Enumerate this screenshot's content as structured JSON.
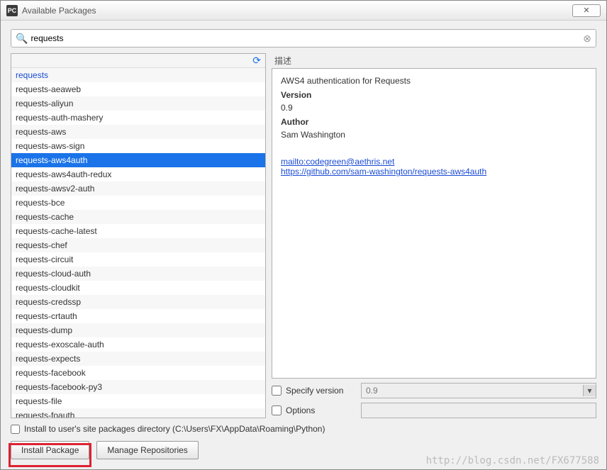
{
  "titlebar": {
    "title": "Available Packages",
    "close": "✕"
  },
  "search": {
    "value": "requests"
  },
  "packages": [
    "requests",
    "requests-aeaweb",
    "requests-aliyun",
    "requests-auth-mashery",
    "requests-aws",
    "requests-aws-sign",
    "requests-aws4auth",
    "requests-aws4auth-redux",
    "requests-awsv2-auth",
    "requests-bce",
    "requests-cache",
    "requests-cache-latest",
    "requests-chef",
    "requests-circuit",
    "requests-cloud-auth",
    "requests-cloudkit",
    "requests-credssp",
    "requests-crtauth",
    "requests-dump",
    "requests-exoscale-auth",
    "requests-expects",
    "requests-facebook",
    "requests-facebook-py3",
    "requests-file",
    "requests-foauth"
  ],
  "selected_index": 6,
  "exact_index": 0,
  "detail": {
    "label": "描述",
    "summary": "AWS4 authentication for Requests",
    "version_label": "Version",
    "version": "0.9",
    "author_label": "Author",
    "author": "Sam Washington",
    "mailto": "mailto:codegreen@aethris.net",
    "repo": "https://github.com/sam-washington/requests-aws4auth"
  },
  "options": {
    "specify_version_label": "Specify version",
    "specify_version_value": "0.9",
    "options_label": "Options",
    "options_value": ""
  },
  "install_dir": {
    "label": "Install to user's site packages directory (C:\\Users\\FX\\AppData\\Roaming\\Python)"
  },
  "buttons": {
    "install": "Install Package",
    "manage": "Manage Repositories"
  },
  "watermark": "http://blog.csdn.net/FX677588"
}
